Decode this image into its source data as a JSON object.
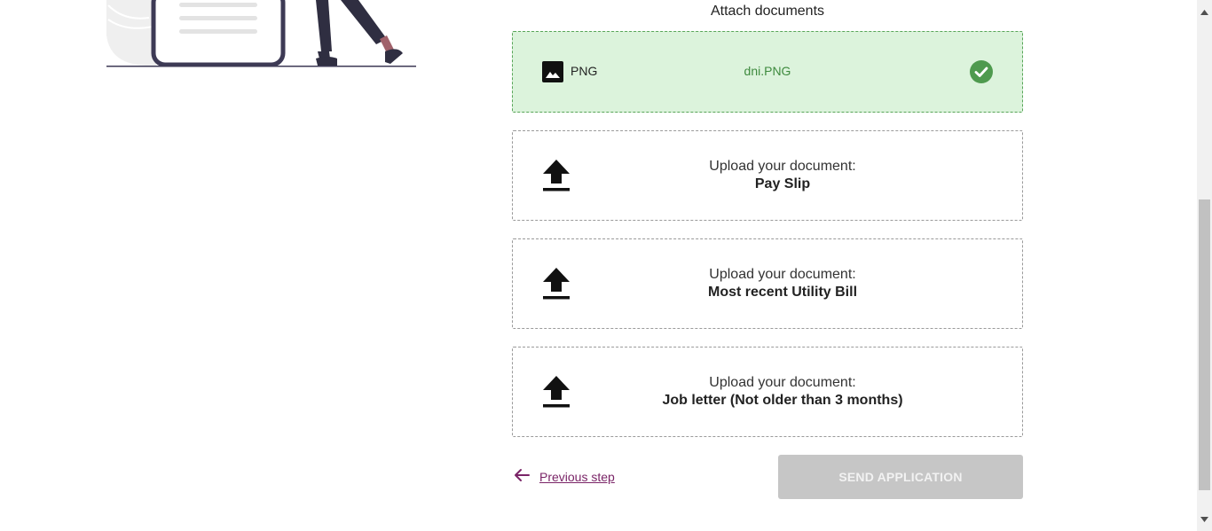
{
  "form": {
    "title": "Attach documents",
    "attached": {
      "file_type": "PNG",
      "file_name": "dni.PNG",
      "status_icon": "check-circle-icon",
      "success_color": "#4e9a4e"
    },
    "upload_prompt": "Upload your document:",
    "uploads": [
      {
        "document": "Pay Slip"
      },
      {
        "document": "Most recent Utility Bill"
      },
      {
        "document": "Job letter (Not older than 3 months)"
      }
    ],
    "previous_label": "Previous step",
    "send_label": "SEND APPLICATION",
    "accent_color": "#7a2467"
  }
}
